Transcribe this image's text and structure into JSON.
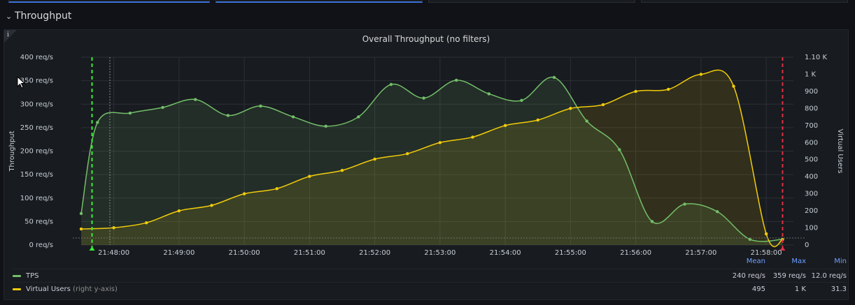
{
  "row": {
    "title": "Throughput",
    "chevron": "chevron-down-icon"
  },
  "panel": {
    "title": "Overall Throughput (no filters)",
    "info_icon": "i"
  },
  "legend": {
    "headers": [
      "Mean",
      "Max",
      "Min"
    ],
    "rows": [
      {
        "name": "TPS",
        "note": "",
        "color": "#73bf69",
        "mean": "240 req/s",
        "max": "359 req/s",
        "min": "12.0 req/s"
      },
      {
        "name": "Virtual Users",
        "note": "(right y-axis)",
        "color": "#f2cc0c",
        "mean": "495",
        "max": "1 K",
        "min": "31.3"
      }
    ]
  },
  "chart_data": {
    "type": "area",
    "title": "Overall Throughput (no filters)",
    "x_ticks": [
      "21:48:00",
      "21:49:00",
      "21:50:00",
      "21:51:00",
      "21:52:00",
      "21:53:00",
      "21:54:00",
      "21:55:00",
      "21:56:00",
      "21:57:00",
      "21:58:00"
    ],
    "x_range": [
      "21:47:30",
      "21:58:25"
    ],
    "y_left": {
      "label": "Throughput",
      "range": [
        0,
        400
      ],
      "ticks": [
        "0 req/s",
        "50 req/s",
        "100 req/s",
        "150 req/s",
        "200 req/s",
        "250 req/s",
        "300 req/s",
        "350 req/s",
        "400 req/s"
      ]
    },
    "y_right": {
      "label": "Virtual Users",
      "range": [
        0,
        1100
      ],
      "ticks": [
        "0",
        "100",
        "200",
        "300",
        "400",
        "500",
        "600",
        "700",
        "800",
        "900",
        "1 K",
        "1.10 K"
      ]
    },
    "grid": true,
    "legend_position": "bottom",
    "series": [
      {
        "name": "TPS",
        "axis": "left",
        "color": "#73bf69",
        "x": [
          "21:47:30",
          "21:47:45",
          "21:48:15",
          "21:48:45",
          "21:49:15",
          "21:49:45",
          "21:50:15",
          "21:50:45",
          "21:51:15",
          "21:51:45",
          "21:52:15",
          "21:52:45",
          "21:53:15",
          "21:53:45",
          "21:54:15",
          "21:54:45",
          "21:55:15",
          "21:55:45",
          "21:56:15",
          "21:56:45",
          "21:57:15",
          "21:57:45",
          "21:58:15"
        ],
        "values": [
          67,
          261,
          281,
          293,
          310,
          276,
          296,
          273,
          253,
          273,
          342,
          313,
          351,
          322,
          308,
          357,
          264,
          203,
          50,
          87,
          71,
          12,
          12
        ]
      },
      {
        "name": "Virtual Users",
        "axis": "right",
        "color": "#f2cc0c",
        "x": [
          "21:47:30",
          "21:48:00",
          "21:48:30",
          "21:49:00",
          "21:49:30",
          "21:50:00",
          "21:50:30",
          "21:51:00",
          "21:51:30",
          "21:52:00",
          "21:52:30",
          "21:53:00",
          "21:53:30",
          "21:54:00",
          "21:54:30",
          "21:55:00",
          "21:55:30",
          "21:56:00",
          "21:56:30",
          "21:57:00",
          "21:57:30",
          "21:58:00",
          "21:58:15"
        ],
        "values": [
          94,
          101,
          130,
          200,
          232,
          300,
          330,
          402,
          437,
          503,
          535,
          600,
          632,
          700,
          732,
          800,
          822,
          900,
          912,
          1000,
          930,
          65,
          31
        ]
      }
    ],
    "markers": [
      {
        "time": "21:47:40",
        "color": "#37f037"
      },
      {
        "time": "21:58:15",
        "color": "#e02f44"
      }
    ]
  }
}
